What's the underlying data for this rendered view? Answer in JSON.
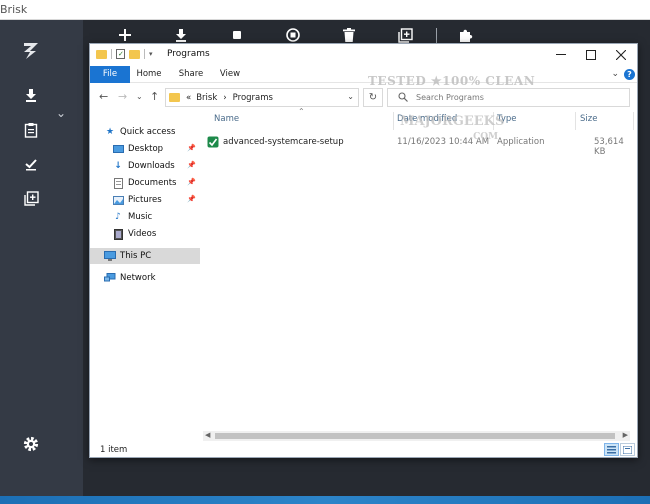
{
  "app": {
    "title": "Brisk"
  },
  "toolbar": {
    "icons": [
      "plus-icon",
      "download-icon",
      "stop-icon",
      "stop-all-icon",
      "trash-icon",
      "add-queue-icon",
      "puzzle-icon"
    ]
  },
  "sidebar": {
    "icons": [
      "brisk-logo",
      "download-icon",
      "clipboard-icon",
      "check-icon",
      "add-queue-icon",
      "gear-icon"
    ]
  },
  "explorer": {
    "window_title": "Programs",
    "ribbon_tabs": [
      "File",
      "Home",
      "Share",
      "View"
    ],
    "address": {
      "prefix": "«",
      "parts": [
        "Brisk",
        "Programs"
      ],
      "separator": "›"
    },
    "search_placeholder": "Search Programs",
    "nav": {
      "quick_access": "Quick access",
      "items": [
        "Desktop",
        "Downloads",
        "Documents",
        "Pictures",
        "Music",
        "Videos"
      ],
      "this_pc": "This PC",
      "network": "Network"
    },
    "columns": [
      "Name",
      "Date modified",
      "Type",
      "Size"
    ],
    "files": [
      {
        "name": "advanced-systemcare-setup",
        "date": "11/16/2023 10:44 AM",
        "type": "Application",
        "size": "53,614 KB"
      }
    ],
    "status": "1 item"
  },
  "watermark": {
    "line1": "TESTED ★100% CLEAN",
    "line2": "MAJORGEEKS",
    "line3": ".COM"
  },
  "colors": {
    "sidebar": "#343a45",
    "main": "#262a31",
    "accent": "#1a74d2"
  }
}
